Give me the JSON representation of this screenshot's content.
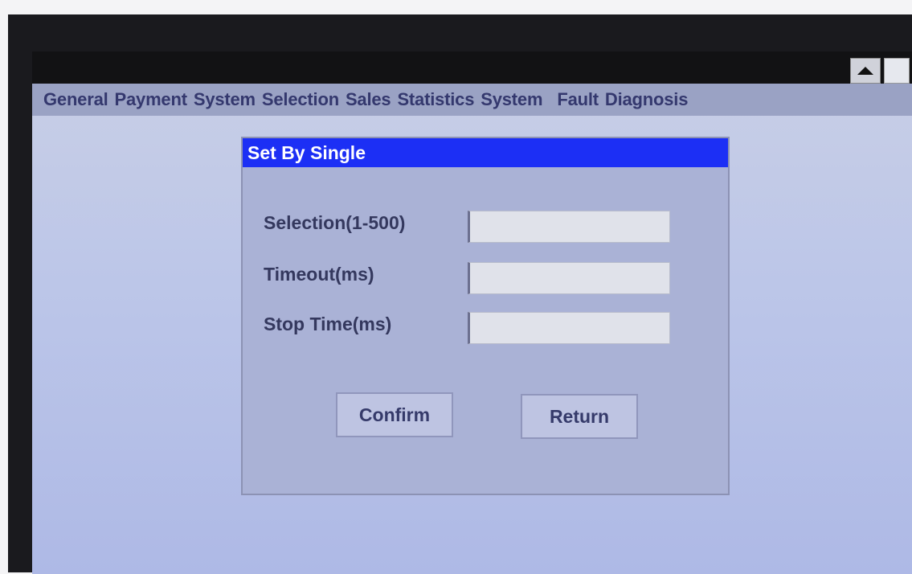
{
  "menubar": {
    "items": [
      "General",
      "Payment",
      "System",
      "Selection",
      "Sales",
      "Statistics",
      "System",
      "Fault",
      "Diagnosis"
    ]
  },
  "dialog": {
    "title": "Set By Single",
    "fields": [
      {
        "label": "Selection(1-500)",
        "value": ""
      },
      {
        "label": "Timeout(ms)",
        "value": ""
      },
      {
        "label": "Stop Time(ms)",
        "value": ""
      }
    ],
    "confirm_label": "Confirm",
    "return_label": "Return"
  },
  "icons": {
    "scroll_up": "triangle-up-icon",
    "window_box": "square-icon"
  },
  "colors": {
    "dialog_title_bg": "#1c2ff5",
    "menubar_text": "#34386e",
    "screen_bg": "#bcc6e8"
  }
}
